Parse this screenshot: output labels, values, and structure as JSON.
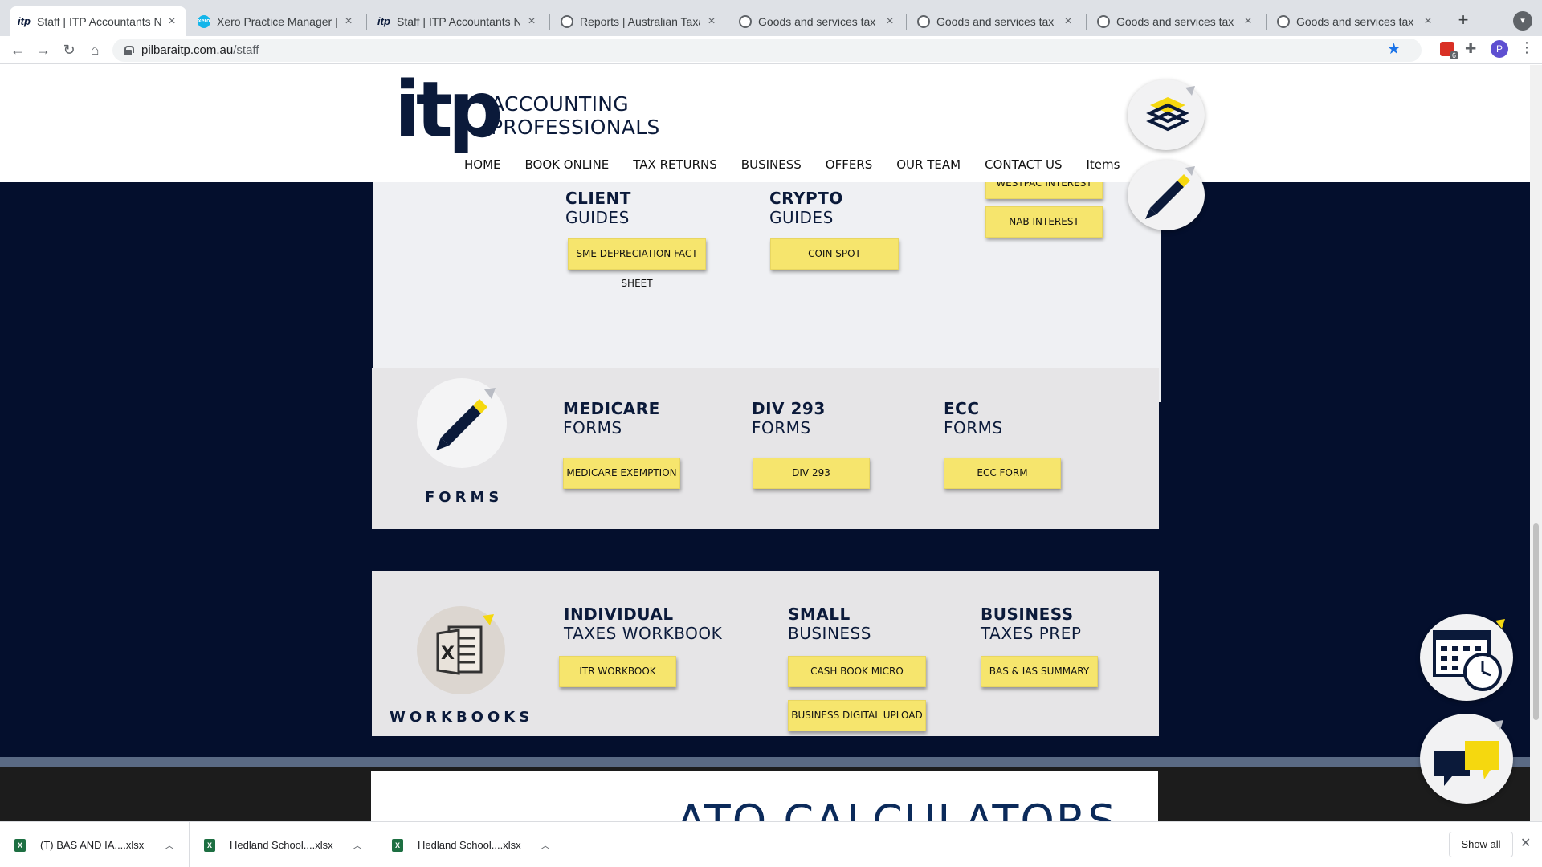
{
  "browser": {
    "tabs": [
      {
        "label": "Staff | ITP Accountants NW",
        "icon": "itp-favicon",
        "active": true
      },
      {
        "label": "Xero Practice Manager | Clie",
        "icon": "xero-favicon"
      },
      {
        "label": "Staff | ITP Accountants NW",
        "icon": "itp-favicon"
      },
      {
        "label": "Reports | Australian Taxation",
        "icon": "globe-icon"
      },
      {
        "label": "Goods and services tax (GS",
        "icon": "globe-icon"
      },
      {
        "label": "Goods and services tax (GS",
        "icon": "globe-icon"
      },
      {
        "label": "Goods and services tax (GS",
        "icon": "globe-icon"
      },
      {
        "label": "Goods and services tax (GS",
        "icon": "globe-icon"
      }
    ],
    "url_host": "pilbaraitp.com.au",
    "url_path": "/staff",
    "extension_badge": "6",
    "profile_initial": "P"
  },
  "site": {
    "logo_mark": "itp",
    "logo_line1": "ACCOUNTING",
    "logo_line2": "PROFESSIONALS",
    "nav": [
      "HOME",
      "BOOK ONLINE",
      "TAX RETURNS",
      "BUSINESS",
      "OFFERS",
      "OUR TEAM",
      "CONTACT US",
      "Items"
    ]
  },
  "guides": {
    "client": {
      "line1": "CLIENT",
      "line2": "GUIDES",
      "buttons": [
        "SME DEPRECIATION FACT SHEET"
      ]
    },
    "crypto": {
      "line1": "CRYPTO",
      "line2": "GUIDES",
      "buttons": [
        "COIN SPOT"
      ]
    },
    "interest": {
      "buttons": [
        "WESTPAC INTEREST",
        "NAB INTEREST"
      ]
    }
  },
  "forms": {
    "label": "FORMS",
    "medicare": {
      "line1": "MEDICARE",
      "line2": "FORMS",
      "button": "MEDICARE EXEMPTION"
    },
    "div293": {
      "line1": "DIV 293",
      "line2": "FORMS",
      "button": "DIV 293"
    },
    "ecc": {
      "line1": "ECC",
      "line2": "FORMS",
      "button": "ECC FORM"
    }
  },
  "workbooks": {
    "label": "WORKBOOKS",
    "individual": {
      "line1": "INDIVIDUAL",
      "line2": "TAXES WORKBOOK",
      "button": "ITR WORKBOOK"
    },
    "small": {
      "line1": "SMALL",
      "line2": "BUSINESS",
      "buttons": [
        "CASH BOOK MICRO",
        "BUSINESS DIGITAL UPLOAD"
      ]
    },
    "business": {
      "line1": "BUSINESS",
      "line2": "TAXES PREP",
      "button": "BAS & IAS SUMMARY"
    }
  },
  "ato": {
    "title": "ATO CALCULATORS"
  },
  "downloads": {
    "items": [
      "(T) BAS AND IA....xlsx",
      "Hedland School....xlsx",
      "Hedland School....xlsx"
    ],
    "show_all": "Show all"
  },
  "colors": {
    "navy": "#040f2d",
    "button_yellow": "#f6e56d",
    "panel_grey": "#e6e5e7"
  }
}
